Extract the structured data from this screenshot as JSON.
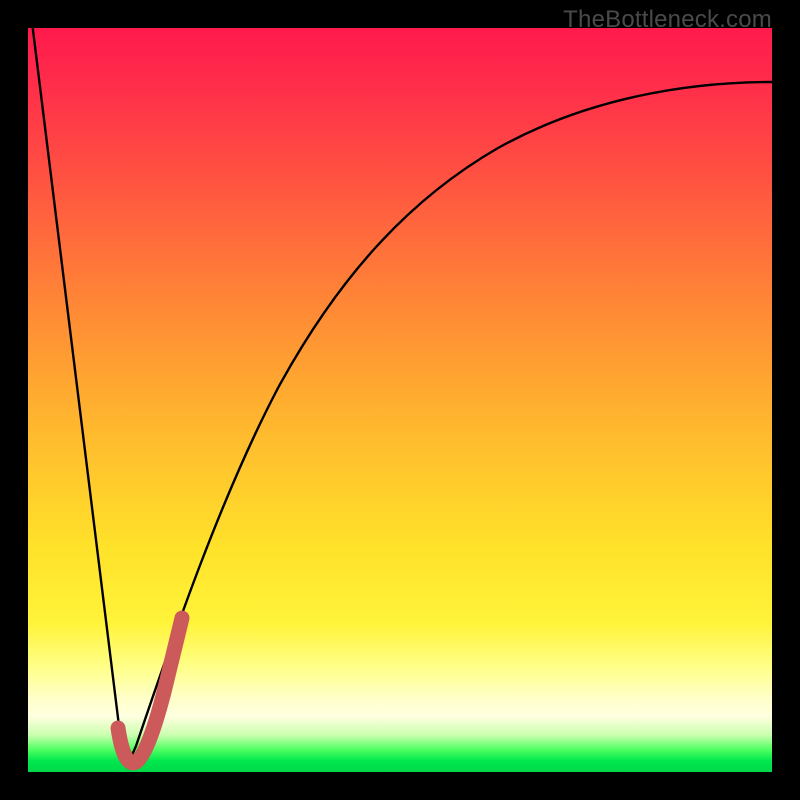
{
  "watermark": {
    "text": "TheBottleneck.com"
  },
  "chart_data": {
    "type": "line",
    "title": "",
    "xlabel": "",
    "ylabel": "",
    "xlim": [
      0,
      100
    ],
    "ylim": [
      0,
      100
    ],
    "grid": false,
    "legend": false,
    "series": [
      {
        "name": "bottleneck-curve",
        "color": "#000000",
        "x": [
          0,
          6,
          11,
          13,
          15,
          18,
          22,
          26,
          30,
          35,
          40,
          46,
          52,
          58,
          65,
          72,
          80,
          88,
          95,
          100
        ],
        "values": [
          100,
          55,
          10,
          1,
          5,
          14,
          28,
          40,
          50,
          59,
          66,
          72,
          77,
          81,
          84,
          87,
          89,
          90,
          91,
          92
        ]
      },
      {
        "name": "highlight-region",
        "color": "#cc5a5a",
        "x": [
          12,
          13,
          14,
          16,
          18
        ],
        "values": [
          5,
          1,
          3,
          9,
          18
        ]
      }
    ],
    "background_gradient": {
      "direction": "vertical",
      "stops": [
        {
          "pos": 0.0,
          "color": "#ff1a4d"
        },
        {
          "pos": 0.22,
          "color": "#ff5840"
        },
        {
          "pos": 0.54,
          "color": "#ffb92e"
        },
        {
          "pos": 0.8,
          "color": "#fff43a"
        },
        {
          "pos": 0.92,
          "color": "#ffffe0"
        },
        {
          "pos": 0.97,
          "color": "#4fff62"
        },
        {
          "pos": 1.0,
          "color": "#00d84a"
        }
      ]
    }
  }
}
